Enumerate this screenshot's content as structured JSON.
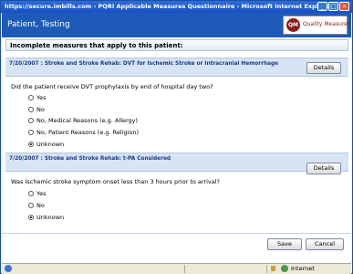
{
  "window": {
    "title": "https://secure.imbills.com - PQRI Applicable Measures Questionnaire - Microsoft Internet Explorer"
  },
  "header": {
    "title": "Patient, Testing",
    "logo_initials": "QM",
    "logo_text": "Quality Measures"
  },
  "section_heading": "Incomplete measures that apply to this patient:",
  "measures": [
    {
      "label": "7/20/2007 : Stroke and Stroke Rehab: DVT for Ischemic Stroke or Intracranial Hemorrhage",
      "details_label": "Details",
      "question": "Did the patient receive DVT prophylaxis by end of hospital day two?",
      "options": [
        {
          "label": "Yes",
          "selected": false
        },
        {
          "label": "No",
          "selected": false
        },
        {
          "label": "No, Medical Reasons (e.g. Allergy)",
          "selected": false
        },
        {
          "label": "No, Patient Reasons (e.g. Religion)",
          "selected": false
        },
        {
          "label": "Unknown",
          "selected": true
        }
      ]
    },
    {
      "label": "7/20/2007 : Stroke and Stroke Rehab: t-PA Considered",
      "details_label": "Details",
      "question": "Was Ischemic stroke symptom onset less than 3 hours prior to arrival?",
      "options": [
        {
          "label": "Yes",
          "selected": false
        },
        {
          "label": "No",
          "selected": false
        },
        {
          "label": "Unknown",
          "selected": true
        }
      ]
    }
  ],
  "footer": {
    "save_label": "Save",
    "cancel_label": "Cancel"
  },
  "statusbar": {
    "zone": "Internet"
  }
}
